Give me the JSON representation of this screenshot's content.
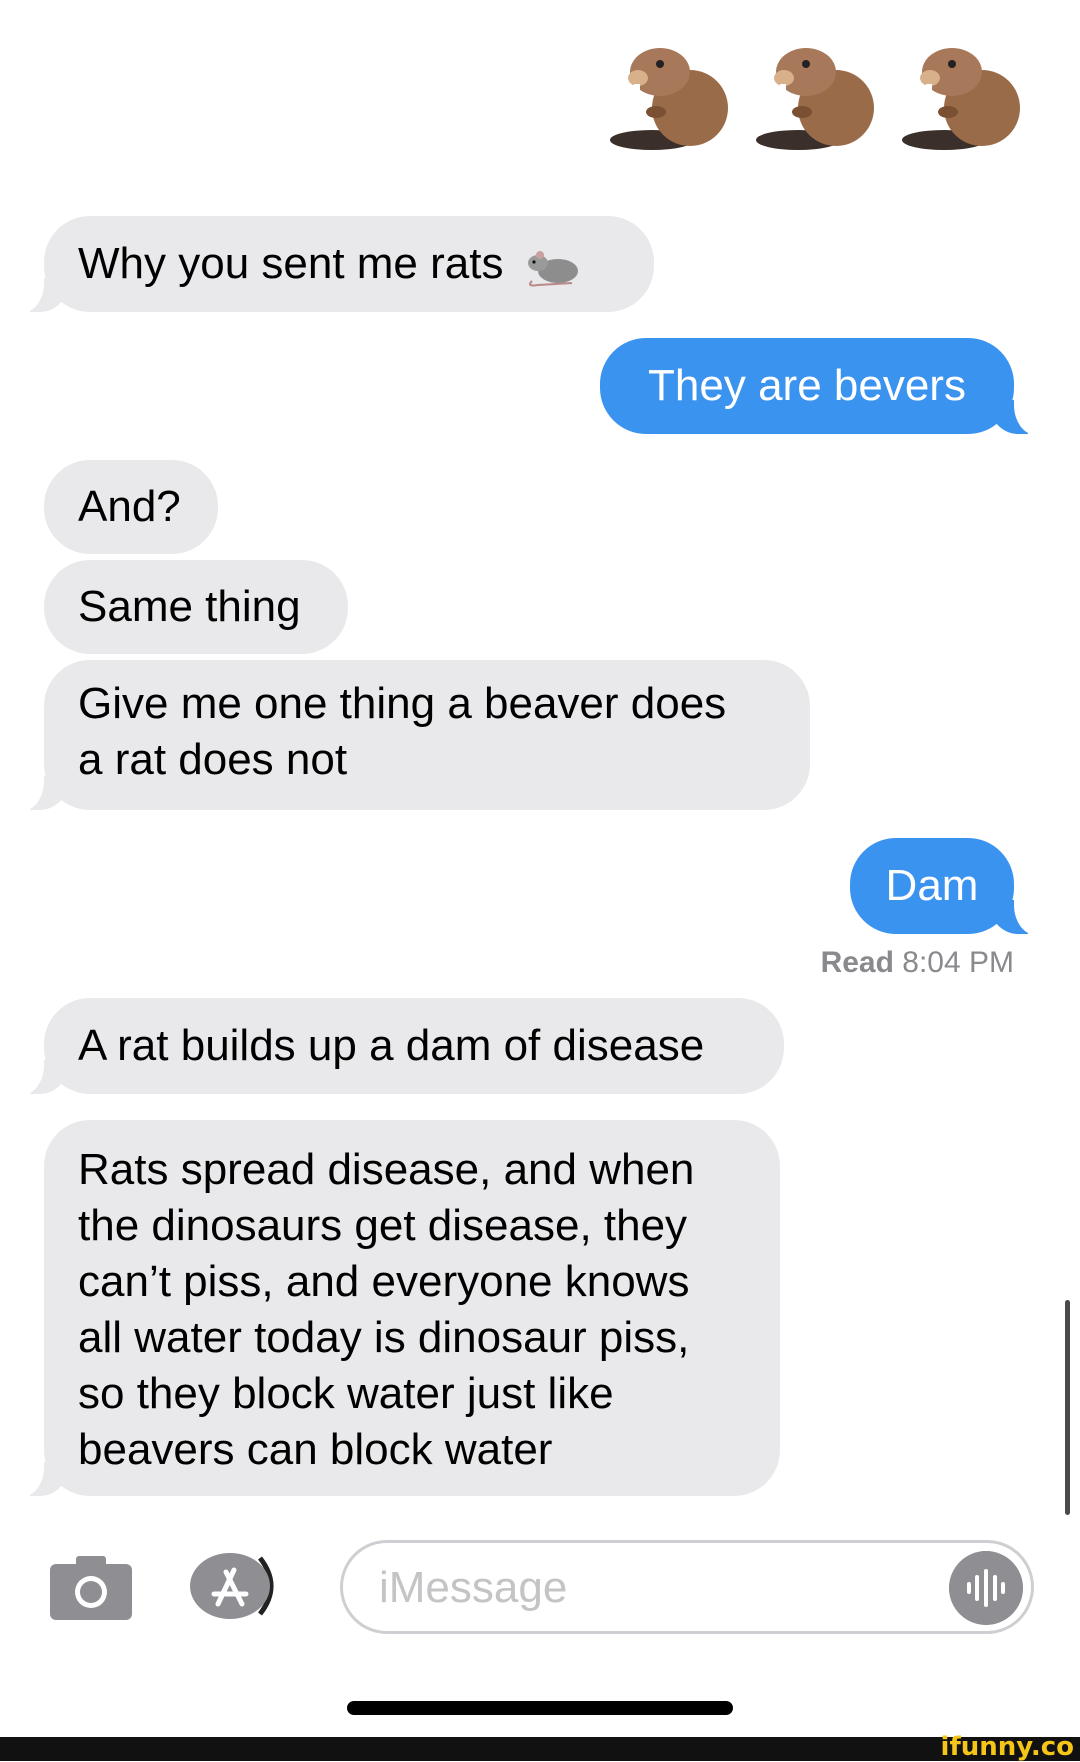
{
  "top_emojis": [
    "beaver-emoji",
    "beaver-emoji",
    "beaver-emoji"
  ],
  "messages": [
    {
      "side": "received",
      "text": "Why you sent me rats",
      "emoji": "rat-emoji"
    },
    {
      "side": "sent",
      "text": "They are bevers"
    },
    {
      "side": "received",
      "text": "And?"
    },
    {
      "side": "received",
      "text": "Same thing"
    },
    {
      "side": "received",
      "lines": [
        "Give me one thing a beaver does",
        "a rat does not"
      ]
    },
    {
      "side": "sent",
      "text": "Dam"
    },
    {
      "side": "received",
      "text": "A rat builds up a dam of disease"
    },
    {
      "side": "received",
      "lines": [
        "Rats spread disease, and when",
        "the dinosaurs get disease, they",
        "can’t piss, and everyone knows",
        "all water today is dinosaur piss,",
        "so they block water just like",
        "beavers can block water"
      ]
    }
  ],
  "receipt": {
    "status": "Read",
    "time": "8:04 PM"
  },
  "composer": {
    "placeholder": "iMessage"
  },
  "watermark": "ifunny.co",
  "colors": {
    "sent_bubble": "#3b93f0",
    "received_bubble": "#e9e9eb"
  }
}
